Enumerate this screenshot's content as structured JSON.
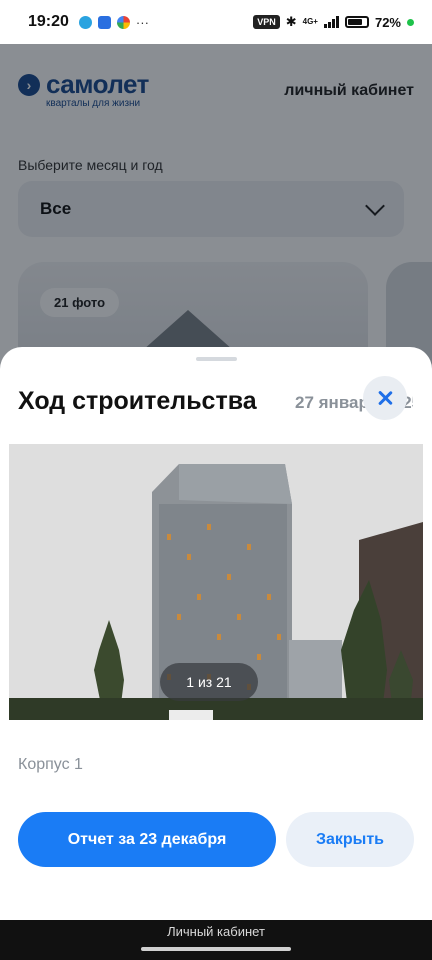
{
  "status_bar": {
    "time": "19:20",
    "vpn": "VPN",
    "network": "4G+",
    "battery": "72%"
  },
  "header": {
    "brand_name": "самолет",
    "brand_tagline": "кварталы для жизни",
    "cabinet_link": "личный кабинет"
  },
  "filter": {
    "label": "Выберите месяц и год",
    "selected": "Все"
  },
  "card": {
    "photo_count": "21 фото"
  },
  "sheet": {
    "title": "Ход строительства",
    "date": "27 января 2025",
    "photo_counter": "1 из 21",
    "building": "Корпус 1",
    "report_button": "Отчет за 23 декабря",
    "close_button": "Закрыть"
  },
  "bottom_bar": {
    "label": "Личный кабинет"
  },
  "colors": {
    "accent": "#1a7cf5",
    "brand": "#1a4a8f",
    "secondary_button_bg": "#eaf0f8"
  }
}
